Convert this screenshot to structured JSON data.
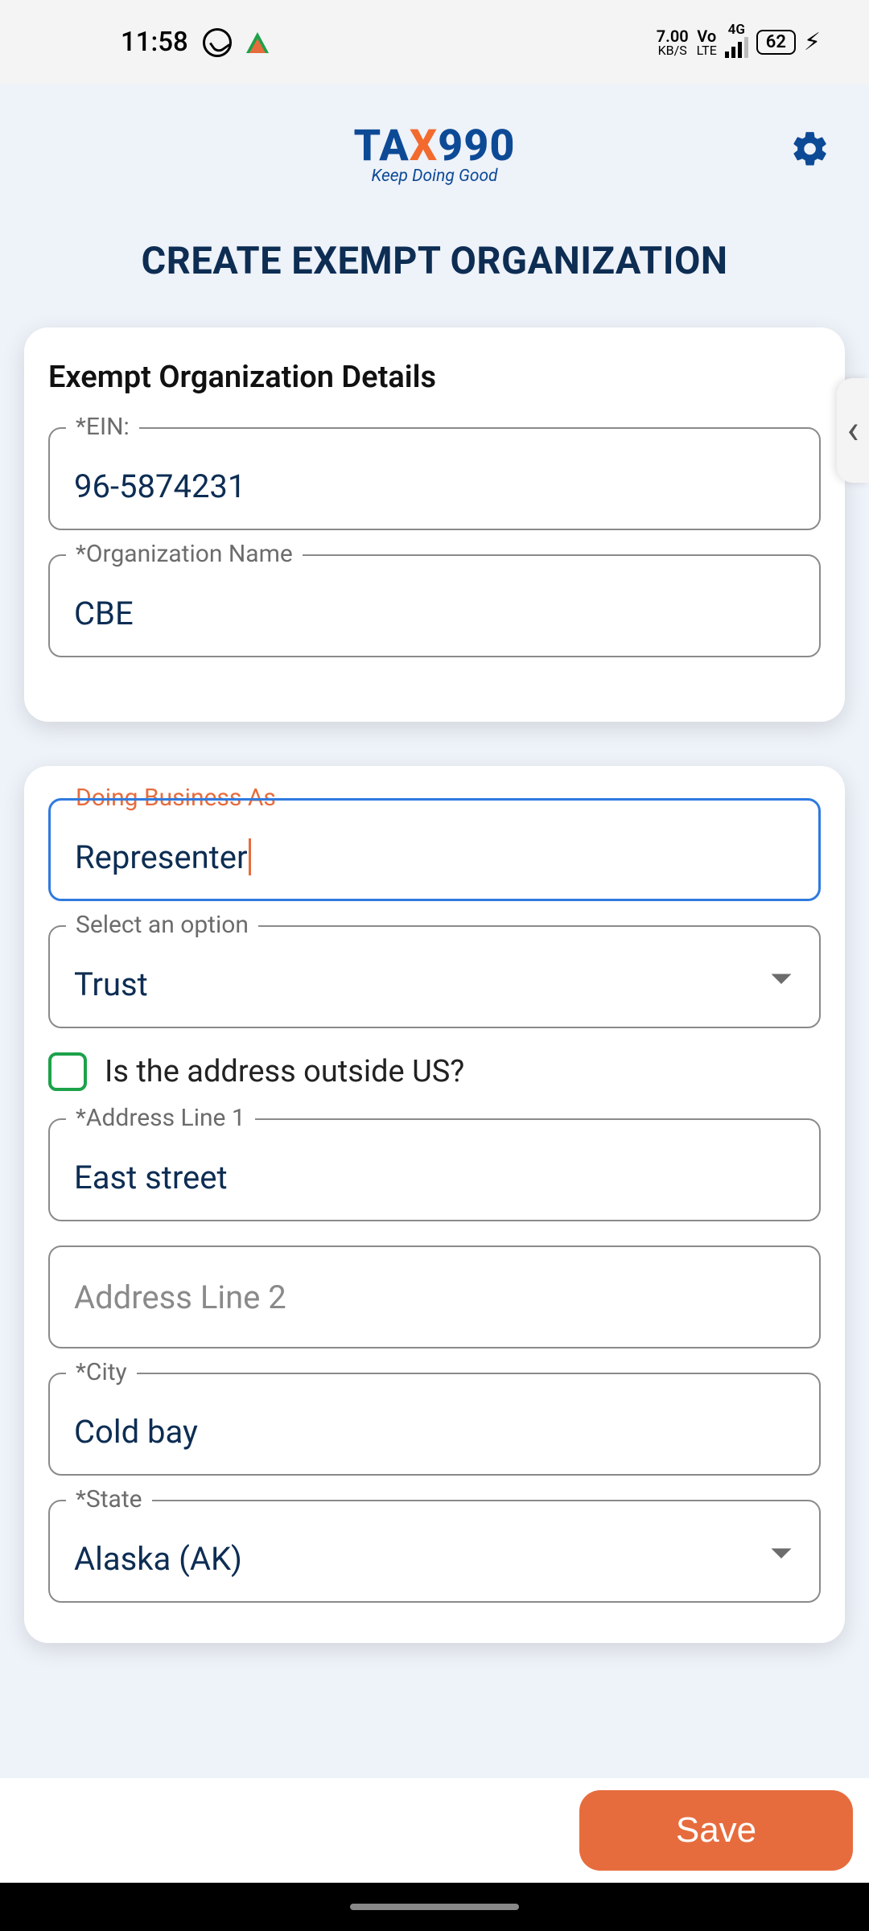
{
  "status": {
    "time": "11:58",
    "net_speed_top": "7.00",
    "net_speed_bot": "KB/S",
    "volte_top": "Vo",
    "volte_bot": "LTE",
    "net_type": "4G",
    "battery": "62"
  },
  "header": {
    "logo_left": "TA",
    "logo_x": "X",
    "logo_right": "990",
    "tagline": "Keep Doing Good"
  },
  "page_title": "CREATE EXEMPT ORGANIZATION",
  "card1": {
    "title": "Exempt Organization Details",
    "ein_label": "*EIN:",
    "ein_value": "96-5874231",
    "orgname_label": "*Organization Name",
    "orgname_value": "CBE"
  },
  "card2": {
    "dba_label": "Doing Business As",
    "dba_value": "Representer",
    "select_label": "Select an option",
    "select_value": "Trust",
    "outside_us_label": "Is the address outside US?",
    "addr1_label": "*Address Line 1",
    "addr1_value": "East street",
    "addr2_placeholder": "Address Line 2",
    "city_label": "*City",
    "city_value": "Cold bay",
    "state_label": "*State",
    "state_value": "Alaska (AK)"
  },
  "save_label": "Save",
  "side_tab_glyph": "‹"
}
